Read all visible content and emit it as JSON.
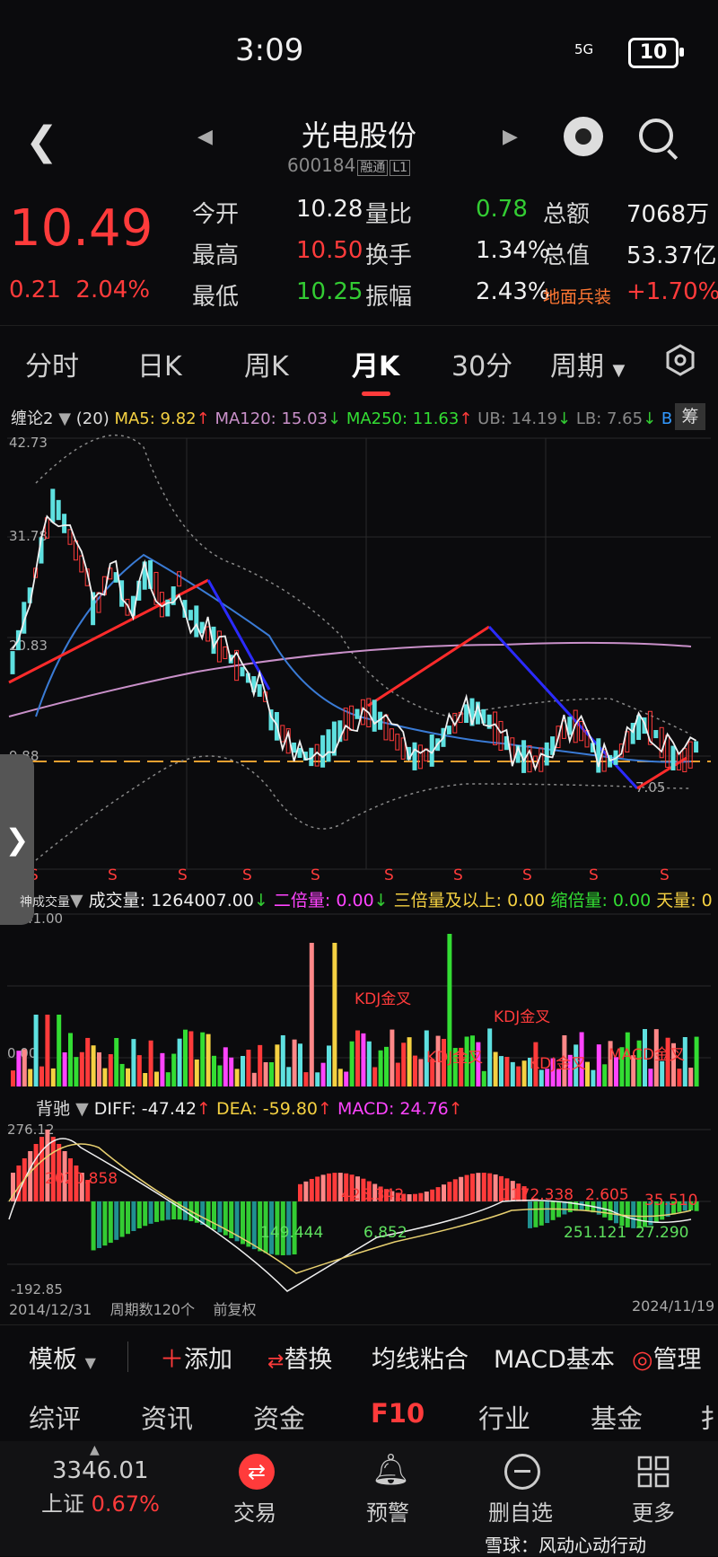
{
  "status": {
    "time": "3:09",
    "signal": "5G",
    "battery": "10"
  },
  "header": {
    "title": "光电股份",
    "code": "600184",
    "tags": [
      "融通",
      "L1"
    ]
  },
  "quote": {
    "price": "10.49",
    "change": "0.21",
    "change_pct": "2.04%",
    "rows": [
      [
        {
          "l": "今开",
          "v": "10.28",
          "c": "wht"
        },
        {
          "l": "量比",
          "v": "0.78",
          "c": "grn"
        },
        {
          "l": "总额",
          "v": "7068万",
          "c": "wht"
        }
      ],
      [
        {
          "l": "最高",
          "v": "10.50",
          "c": "red"
        },
        {
          "l": "换手",
          "v": "1.34%",
          "c": "wht"
        },
        {
          "l": "总值",
          "v": "53.37亿",
          "c": "wht"
        }
      ],
      [
        {
          "l": "最低",
          "v": "10.25",
          "c": "grn"
        },
        {
          "l": "振幅",
          "v": "2.43%",
          "c": "wht"
        },
        {
          "l": "地面兵装",
          "v": "+1.70%",
          "c": "red"
        }
      ]
    ]
  },
  "tabs": [
    "分时",
    "日K",
    "周K",
    "月K",
    "30分",
    "周期"
  ],
  "active_tab": "月K",
  "kline_legend": {
    "name": "缠论2",
    "period": "(20)",
    "ma5": "MA5: 9.82",
    "ma120": "MA120: 15.03",
    "ma250": "MA250: 11.63",
    "ub": "UB: 14.19",
    "lb": "LB: 7.65",
    "b": "B",
    "chip": "筹"
  },
  "kline_axis": {
    "top": "42.73",
    "l2": "31.78",
    "l3": "20.83",
    "l4": "9.88",
    "low_mark": "7.05"
  },
  "sell_marks": "S",
  "volume_legend": {
    "name": "神成交量",
    "vol": "成交量: 1264007.00",
    "v2": "二倍量: 0.00",
    "v3": "三倍量及以上: 0.00",
    "v4": "缩倍量: 0.00",
    "v5": "天量: 0",
    "axis_top": "4541.00",
    "axis_bottom": "0.00"
  },
  "volume_marks": [
    "KDJ金叉",
    "KDJ金叉",
    "KDJ金叉",
    "KDJ金叉",
    "MACD金叉"
  ],
  "macd_legend": {
    "name": "背驰",
    "diff": "DIFF: -47.42",
    "dea": "DEA: -59.80",
    "macd": "MACD: 24.76",
    "axis_top": "276.12",
    "axis_bottom": "-192.85"
  },
  "macd_labels": [
    "2020.858",
    "425.342",
    "1172.338",
    "2.605",
    "35.510",
    "149.444",
    "6.852",
    "251.121",
    "27.290"
  ],
  "footer_axis": {
    "start": "2014/12/31",
    "count": "周期数120个",
    "adj": "前复权",
    "end": "2024/11/19"
  },
  "toolbar": {
    "template": "模板",
    "add": "添加",
    "replace": "替换",
    "ma": "均线粘合",
    "macd": "MACD基本",
    "manage": "管理"
  },
  "ftabs": [
    "综评",
    "资讯",
    "资金",
    "F10",
    "行业",
    "基金",
    "扌"
  ],
  "nav": {
    "index_value": "3346.01",
    "index_name": "上证",
    "index_pct": "0.67%",
    "trade": "交易",
    "alert": "预警",
    "remove": "删自选",
    "more": "更多",
    "watermark": "雪球：风动心动行动"
  },
  "colors": {
    "up": "#ff3b3b",
    "down": "#33cc33",
    "accent": "#ff3b3b"
  },
  "icons": [
    "back-icon",
    "robot-icon",
    "search-icon",
    "settings-hex-icon",
    "chevron-right-icon",
    "trade-icon",
    "bell-icon",
    "minus-circle-icon",
    "grid-icon"
  ]
}
